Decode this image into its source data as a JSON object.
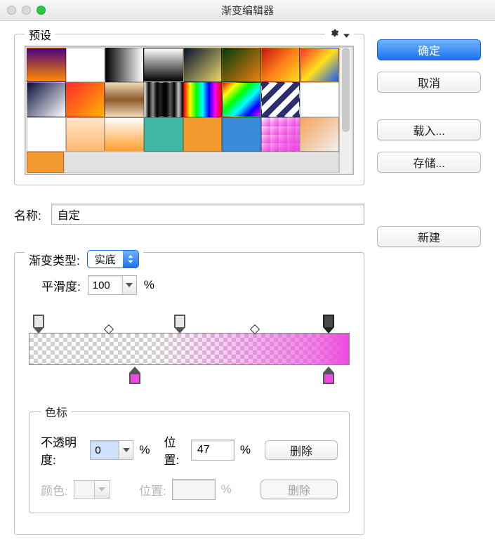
{
  "window": {
    "title": "渐变编辑器"
  },
  "buttons": {
    "ok": "确定",
    "cancel": "取消",
    "load": "载入...",
    "save": "存储...",
    "new": "新建",
    "delete": "删除",
    "delete2": "删除"
  },
  "presets": {
    "label": "预设"
  },
  "name": {
    "label": "名称:",
    "value": "自定"
  },
  "gradient": {
    "type_label": "渐变类型:",
    "type_value": "实底",
    "smooth_label": "平滑度:",
    "smooth_value": "100",
    "smooth_unit": "%"
  },
  "editor": {
    "opacity_stops": [
      {
        "pos": 3,
        "selected": false
      },
      {
        "pos": 47,
        "selected": false
      },
      {
        "pos": 93.5,
        "selected": true
      }
    ],
    "midpoints": [
      {
        "pos": 25
      },
      {
        "pos": 70.5
      }
    ],
    "color_stops": [
      {
        "pos": 33,
        "color": "#ee49e0"
      },
      {
        "pos": 93.5,
        "color": "#ee49e0"
      }
    ]
  },
  "stops": {
    "legend": "色标",
    "opacity_label": "不透明度:",
    "opacity_value": "0",
    "opacity_unit": "%",
    "pos_label": "位置:",
    "pos_value": "47",
    "pos_unit": "%",
    "color_label": "颜色:",
    "pos2_label": "位置:",
    "pos2_value": "",
    "pos2_unit": "%"
  },
  "swatches": [
    [
      "linear-gradient(#4a0080,#ff8c00)",
      "linear-gradient(135deg,#ffffff,rgba(255,255,255,0))",
      "linear-gradient(90deg,#000,#fff)",
      "linear-gradient(#fff,#000)",
      "linear-gradient(135deg,#06122e,#e9d76b)",
      "linear-gradient(135deg,#003d0a,#f07f13)",
      "linear-gradient(135deg,#c31414,#ff7d19,#ffe11a)",
      "linear-gradient(135deg,#ff2e2e,#ffe11a,#1259ff)"
    ],
    [
      "linear-gradient(135deg,#0a0f3d,#ffffff)",
      "linear-gradient(135deg,#ff2b2b,#ffb300)",
      "linear-gradient(#efd8b4,#8c5a2b,#efd8b4)",
      "linear-gradient(90deg,rgba(0,0,0,0),#000,rgba(0,0,0,0))",
      "linear-gradient(90deg,#ff0000,#ffff00,#00ff00,#00ffff,#0000ff,#ff00ff,#ff0000)",
      "linear-gradient(135deg,#ff0000,#ffff00,#00ff00,#00ffff,#0000ff,#ff00ff)",
      "repeating-linear-gradient(135deg,#2b2f6c 0 8px,#fff 8px 16px)",
      "linear-gradient(135deg,rgba(255,255,255,0),#ffffff)"
    ],
    [
      "linear-gradient(#fff,rgba(255,255,255,0))",
      "linear-gradient(#ffe6cc,#ffb870)",
      "linear-gradient(#fff,#ff9e2e)",
      "#3fb9a3",
      "#f29a2e",
      "#3a8bd8",
      "linear-gradient(135deg,rgba(240,71,224,0),#f047e0)",
      "linear-gradient(135deg,#f8a35b,#efefef)"
    ]
  ],
  "swatch_last": "#f29a2e"
}
